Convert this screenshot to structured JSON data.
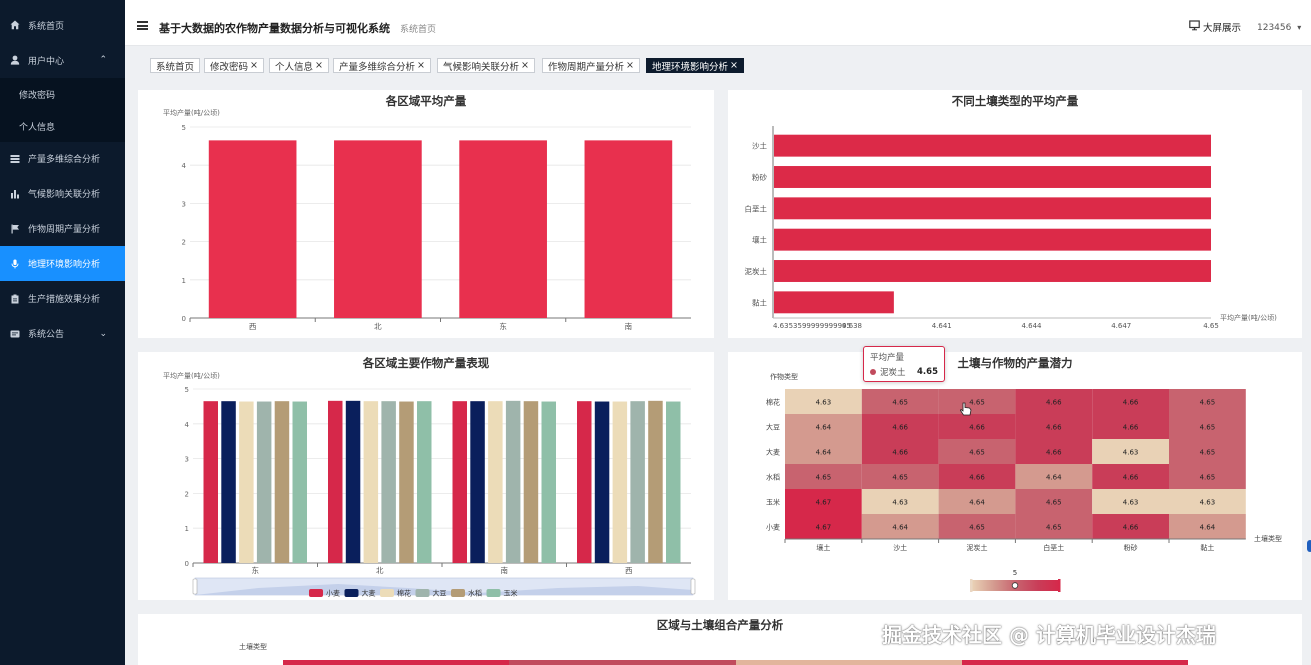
{
  "sidebar": {
    "items": [
      {
        "label": "系统首页",
        "icon": "home-icon"
      },
      {
        "label": "用户中心",
        "icon": "user-icon",
        "expanded": true
      },
      {
        "label": "修改密码",
        "sub": true
      },
      {
        "label": "个人信息",
        "sub": true
      },
      {
        "label": "产量多维综合分析",
        "icon": "layers-icon"
      },
      {
        "label": "气候影响关联分析",
        "icon": "bar-chart-icon"
      },
      {
        "label": "作物周期产量分析",
        "icon": "flag-icon"
      },
      {
        "label": "地理环境影响分析",
        "icon": "microphone-icon",
        "active": true
      },
      {
        "label": "生产措施效果分析",
        "icon": "clipboard-icon"
      },
      {
        "label": "系统公告",
        "icon": "notice-icon",
        "collapsible": true
      }
    ],
    "chevron_up": "⌃",
    "chevron_down": "⌄"
  },
  "header": {
    "title": "基于大数据的农作物产量数据分析与可视化系统",
    "breadcrumb": "系统首页",
    "screen_button": "大屏展示",
    "username": "123456",
    "caret": "▾"
  },
  "tabs": [
    {
      "label": "系统首页",
      "closable": false
    },
    {
      "label": "修改密码",
      "closable": true
    },
    {
      "label": "个人信息",
      "closable": true
    },
    {
      "label": "产量多维综合分析",
      "closable": true
    },
    {
      "label": "气候影响关联分析",
      "closable": true
    },
    {
      "label": "作物周期产量分析",
      "closable": true
    },
    {
      "label": "地理环境影响分析",
      "closable": true,
      "active": true
    }
  ],
  "close_glyph": "×",
  "colors": {
    "accent": "#1890ff",
    "sidebar_bg": "#0c1a2c",
    "bar_red": "#e8304e"
  },
  "chart_data": [
    {
      "type": "bar",
      "title": "各区域平均产量",
      "ylabel": "平均产量(吨/公顷)",
      "categories": [
        "西",
        "北",
        "东",
        "南"
      ],
      "values": [
        4.65,
        4.65,
        4.65,
        4.65
      ],
      "ylim": [
        0,
        5
      ],
      "yticks": [
        0,
        1,
        2,
        3,
        4,
        5
      ],
      "grid": true
    },
    {
      "type": "bar",
      "orientation": "horizontal",
      "title": "不同土壤类型的平均产量",
      "xlabel": "平均产量(吨/公顷)",
      "categories": [
        "沙土",
        "粉砂",
        "白垩土",
        "壤土",
        "泥炭土",
        "黏土"
      ],
      "values": [
        4.65,
        4.65,
        4.65,
        4.65,
        4.65,
        4.6394
      ],
      "xlim": [
        4.6353599999999995,
        4.65
      ],
      "xticks": [
        "4.6353599999999995",
        "4.638",
        "4.641",
        "4.644",
        "4.647",
        "4.65"
      ]
    },
    {
      "type": "bar",
      "title": "各区域主要作物产量表现",
      "ylabel": "平均产量(吨/公顷)",
      "categories": [
        "东",
        "北",
        "南",
        "西"
      ],
      "series": [
        {
          "name": "小麦",
          "color": "#d6284a",
          "values": [
            4.65,
            4.66,
            4.65,
            4.65
          ]
        },
        {
          "name": "大麦",
          "color": "#0a1f5c",
          "values": [
            4.65,
            4.66,
            4.65,
            4.64
          ]
        },
        {
          "name": "棉花",
          "color": "#ecdcb8",
          "values": [
            4.64,
            4.65,
            4.65,
            4.64
          ]
        },
        {
          "name": "大豆",
          "color": "#9fb4ac",
          "values": [
            4.64,
            4.65,
            4.66,
            4.65
          ]
        },
        {
          "name": "水稻",
          "color": "#b49c76",
          "values": [
            4.65,
            4.64,
            4.65,
            4.66
          ]
        },
        {
          "name": "玉米",
          "color": "#8fbfa8",
          "values": [
            4.64,
            4.65,
            4.64,
            4.64
          ]
        }
      ],
      "ylim": [
        0,
        5
      ],
      "yticks": [
        0,
        1,
        2,
        3,
        4,
        5
      ]
    },
    {
      "type": "heatmap",
      "title": "土壤与作物的产量潜力",
      "xlabel": "土壤类型",
      "ylabel": "作物类型",
      "x": [
        "壤土",
        "沙土",
        "泥炭土",
        "白垩土",
        "粉砂",
        "黏土"
      ],
      "y": [
        "棉花",
        "大豆",
        "大麦",
        "水稻",
        "玉米",
        "小麦"
      ],
      "values": [
        [
          4.63,
          4.65,
          4.65,
          4.66,
          4.66,
          4.65
        ],
        [
          4.64,
          4.66,
          4.66,
          4.66,
          4.66,
          4.65
        ],
        [
          4.64,
          4.66,
          4.65,
          4.66,
          4.63,
          4.65
        ],
        [
          4.65,
          4.65,
          4.66,
          4.64,
          4.66,
          4.65
        ],
        [
          4.67,
          4.63,
          4.64,
          4.65,
          4.63,
          4.63
        ],
        [
          4.67,
          4.64,
          4.65,
          4.65,
          4.66,
          4.64
        ]
      ],
      "visual_map_label": "5",
      "tooltip": {
        "title": "平均产量",
        "name": "泥炭土",
        "value": "4.65"
      }
    },
    {
      "type": "heatmap",
      "title": "区域与土壤组合产量分析",
      "ylabel": "土壤类型"
    }
  ],
  "watermark": "掘金技术社区 @ 计算机毕业设计杰瑞"
}
